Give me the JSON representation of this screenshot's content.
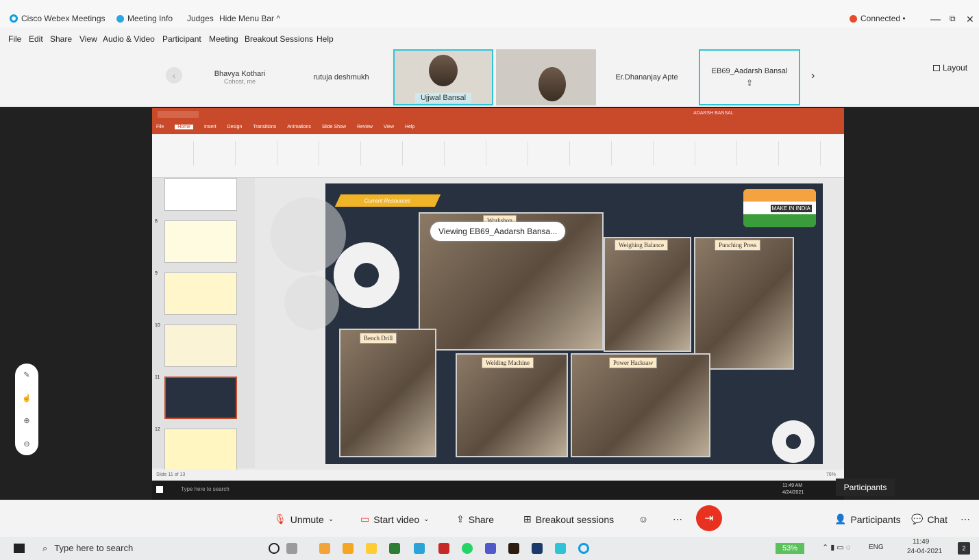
{
  "titlebar": {
    "app": "Cisco Webex Meetings",
    "meeting_info": "Meeting Info",
    "judges": "Judges",
    "hide_menu": "Hide Menu Bar ^",
    "status": "Connected •"
  },
  "menu": [
    "File",
    "Edit",
    "Share",
    "View",
    "Audio & Video",
    "Participant",
    "Meeting",
    "Breakout Sessions",
    "Help"
  ],
  "participants_strip": [
    {
      "name": "Bhavya Kothari",
      "sub": "Cohost, me"
    },
    {
      "name": "rutuja deshmukh",
      "sub": ""
    },
    {
      "name": "Ujjwal Bansal",
      "sub": ""
    },
    {
      "name": "",
      "sub": ""
    },
    {
      "name": "Er.Dhananjay Apte",
      "sub": ""
    },
    {
      "name": "EB69_Aadarsh Bansal",
      "sub": ""
    }
  ],
  "layout_label": "Layout",
  "viewing": "Viewing EB69_Aadarsh Bansa...",
  "ppt": {
    "tabs": [
      "File",
      "Home",
      "Insert",
      "Design",
      "Transitions",
      "Animations",
      "Slide Show",
      "Review",
      "View",
      "Help"
    ],
    "user": "ADARSH BANSAL",
    "slide_numbers": [
      "8",
      "9",
      "10",
      "11",
      "12"
    ],
    "slide_header": "Current Resources",
    "logo": "MAKE IN INDIA",
    "captions": [
      "Workshop",
      "Weighing Balance",
      "Punching Press",
      "Bench Drill",
      "Welding Machine",
      "Power Hacksaw"
    ],
    "status_left": "Slide 11 of 13",
    "search": "Type here to search",
    "zoom": "76%",
    "inner_time": "11:49 AM",
    "inner_date": "4/24/2021"
  },
  "participants_tip": "Participants",
  "controls": {
    "unmute": "Unmute",
    "start_video": "Start video",
    "share": "Share",
    "breakout": "Breakout sessions",
    "participants": "Participants",
    "chat": "Chat"
  },
  "taskbar": {
    "search": "Type here to search",
    "battery": "53%",
    "lang": "ENG",
    "time": "11:49",
    "date": "24-04-2021",
    "notif": "2"
  },
  "colors": {
    "accent": "#2ec4d6",
    "leave": "#e8321f",
    "ppt": "#c94a2b",
    "slide_bg": "#27313f"
  }
}
